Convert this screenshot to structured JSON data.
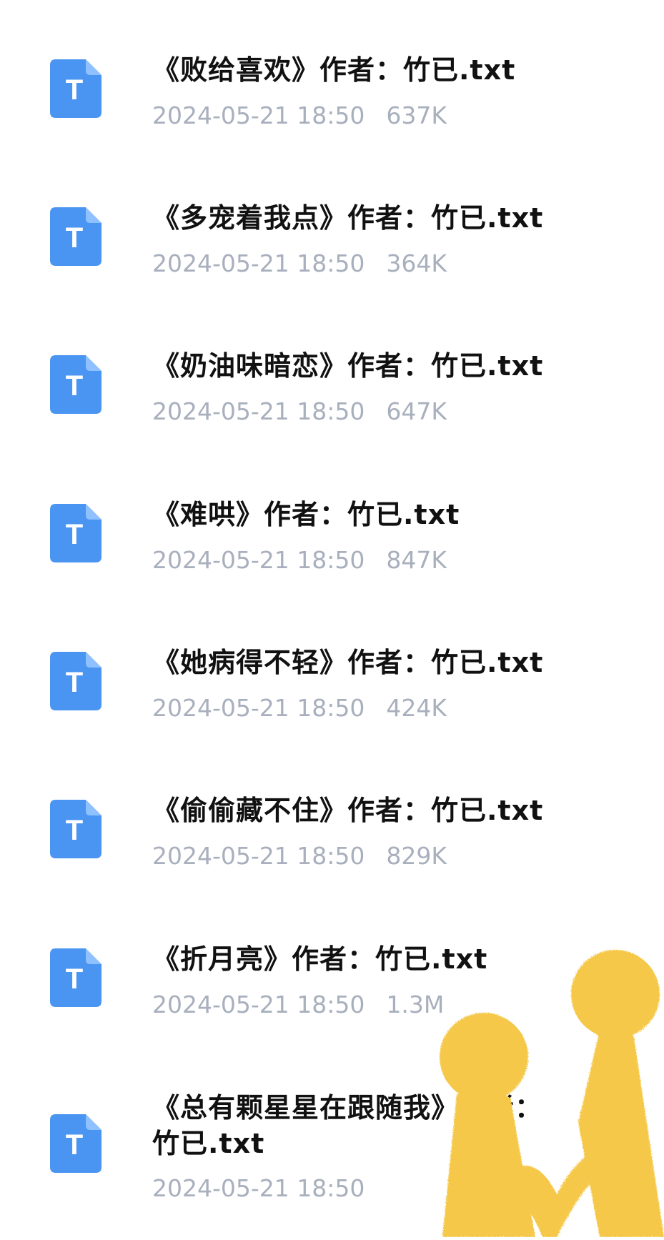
{
  "files": [
    {
      "name": "《败给喜欢》作者：竹已.txt",
      "date": "2024-05-21 18:50",
      "size": "637K",
      "icon": "text-file-icon"
    },
    {
      "name": "《多宠着我点》作者：竹已.txt",
      "date": "2024-05-21 18:50",
      "size": "364K",
      "icon": "text-file-icon"
    },
    {
      "name": "《奶油味暗恋》作者：竹已.txt",
      "date": "2024-05-21 18:50",
      "size": "647K",
      "icon": "text-file-icon"
    },
    {
      "name": "《难哄》作者：竹已.txt",
      "date": "2024-05-21 18:50",
      "size": "847K",
      "icon": "text-file-icon"
    },
    {
      "name": "《她病得不轻》作者：竹已.txt",
      "date": "2024-05-21 18:50",
      "size": "424K",
      "icon": "text-file-icon"
    },
    {
      "name": "《偷偷藏不住》作者：竹已.txt",
      "date": "2024-05-21 18:50",
      "size": "829K",
      "icon": "text-file-icon"
    },
    {
      "name": "《折月亮》作者：竹已.txt",
      "date": "2024-05-21 18:50",
      "size": "1.3M",
      "icon": "text-file-icon"
    },
    {
      "name": "《总有颗星星在跟随我》作者：竹已.txt",
      "date": "2024-05-21 18:50",
      "size": "",
      "icon": "text-file-icon"
    }
  ],
  "icon_glyph": "T",
  "colors": {
    "icon_blue": "#4a94f2",
    "icon_fold": "#8fc0ff",
    "meta_gray": "#a8afbd",
    "mascot_yellow": "#f5c84a"
  },
  "overlay": {
    "icon": "yellow-fuzzy-figures-sticker-icon"
  }
}
